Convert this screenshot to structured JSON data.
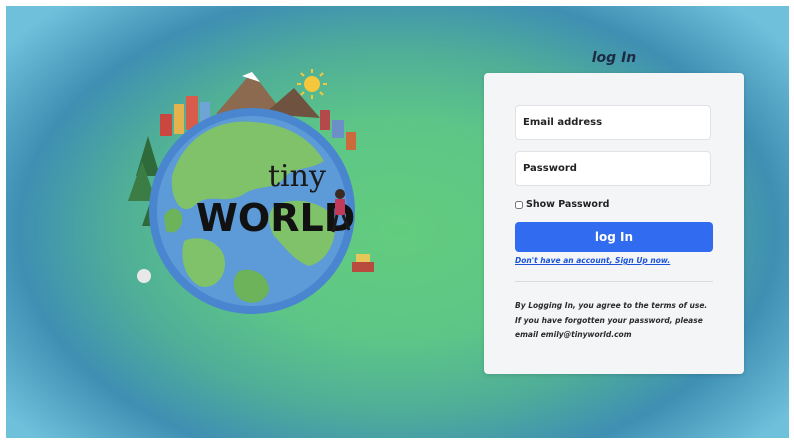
{
  "logo": {
    "line1": "tiny",
    "line2": "WORLD"
  },
  "login": {
    "title": "log In",
    "email_placeholder": "Email address",
    "password_placeholder": "Password",
    "show_password_label": "Show Password",
    "button_label": "log In",
    "signup_link": "Don't have an account, Sign Up now.",
    "terms_line1": "By Logging In, you agree to the terms of use.",
    "terms_line2": "If you have forgotten your password, please",
    "terms_line3": "email emily@tinyworld.com"
  },
  "colors": {
    "accent": "#316cf0",
    "link": "#1c53d8",
    "background_center": "#62cc7e",
    "background_edge": "#6fc0db"
  }
}
